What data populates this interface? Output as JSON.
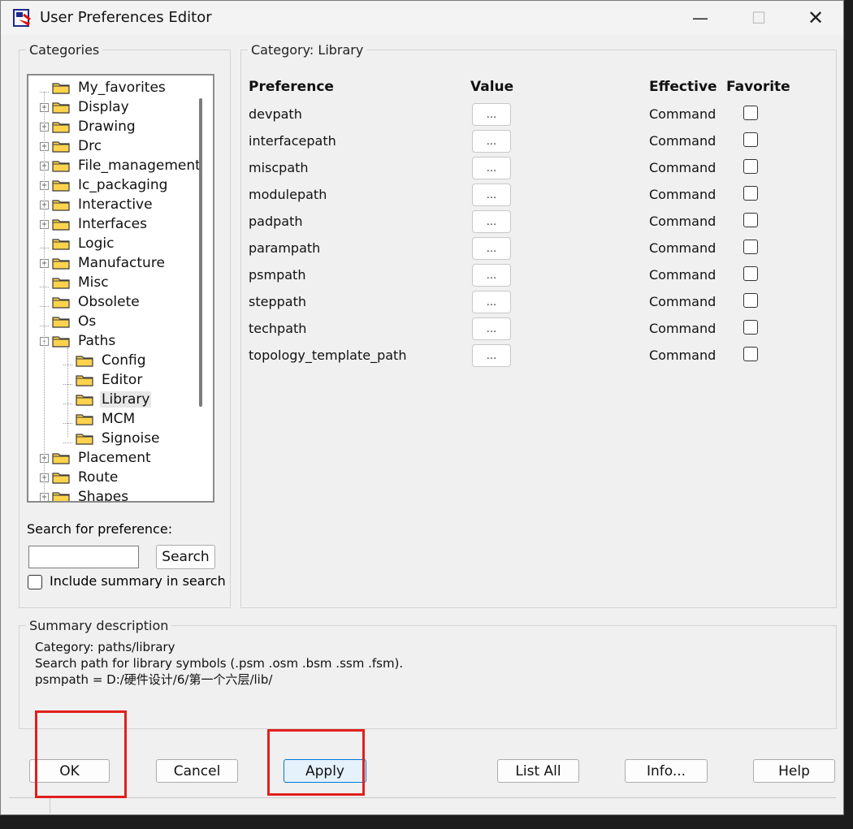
{
  "window": {
    "title": "User Preferences Editor"
  },
  "categories": {
    "label": "Categories",
    "tree": [
      {
        "label": "My_favorites",
        "expander": "",
        "level": 0
      },
      {
        "label": "Display",
        "expander": "+",
        "level": 0
      },
      {
        "label": "Drawing",
        "expander": "+",
        "level": 0
      },
      {
        "label": "Drc",
        "expander": "+",
        "level": 0
      },
      {
        "label": "File_management",
        "expander": "+",
        "level": 0
      },
      {
        "label": "Ic_packaging",
        "expander": "+",
        "level": 0
      },
      {
        "label": "Interactive",
        "expander": "+",
        "level": 0
      },
      {
        "label": "Interfaces",
        "expander": "+",
        "level": 0
      },
      {
        "label": "Logic",
        "expander": "",
        "level": 0
      },
      {
        "label": "Manufacture",
        "expander": "+",
        "level": 0
      },
      {
        "label": "Misc",
        "expander": "",
        "level": 0
      },
      {
        "label": "Obsolete",
        "expander": "",
        "level": 0
      },
      {
        "label": "Os",
        "expander": "",
        "level": 0
      },
      {
        "label": "Paths",
        "expander": "-",
        "level": 0
      },
      {
        "label": "Config",
        "expander": "",
        "level": 1
      },
      {
        "label": "Editor",
        "expander": "",
        "level": 1
      },
      {
        "label": "Library",
        "expander": "",
        "level": 1,
        "selected": true
      },
      {
        "label": "MCM",
        "expander": "",
        "level": 1
      },
      {
        "label": "Signoise",
        "expander": "",
        "level": 1
      },
      {
        "label": "Placement",
        "expander": "+",
        "level": 0
      },
      {
        "label": "Route",
        "expander": "+",
        "level": 0
      },
      {
        "label": "Shapes",
        "expander": "+",
        "level": 0
      }
    ]
  },
  "search": {
    "label": "Search for preference:",
    "value": "",
    "button": "Search",
    "include_summary_label": "Include summary in search",
    "include_summary_checked": false
  },
  "category_panel": {
    "label": "Category:  Library",
    "headers": {
      "preference": "Preference",
      "value": "Value",
      "effective": "Effective",
      "favorite": "Favorite"
    },
    "rows": [
      {
        "name": "devpath",
        "value_btn": "...",
        "effective": "Command"
      },
      {
        "name": "interfacepath",
        "value_btn": "...",
        "effective": "Command"
      },
      {
        "name": "miscpath",
        "value_btn": "...",
        "effective": "Command"
      },
      {
        "name": "modulepath",
        "value_btn": "...",
        "effective": "Command"
      },
      {
        "name": "padpath",
        "value_btn": "...",
        "effective": "Command"
      },
      {
        "name": "parampath",
        "value_btn": "...",
        "effective": "Command"
      },
      {
        "name": "psmpath",
        "value_btn": "...",
        "effective": "Command"
      },
      {
        "name": "steppath",
        "value_btn": "...",
        "effective": "Command"
      },
      {
        "name": "techpath",
        "value_btn": "...",
        "effective": "Command"
      },
      {
        "name": "topology_template_path",
        "value_btn": "...",
        "effective": "Command"
      }
    ]
  },
  "summary": {
    "label": "Summary description",
    "lines": [
      "Category: paths/library",
      "Search path for library symbols (.psm .osm .bsm .ssm .fsm).",
      "psmpath = D:/硬件设计/6/第一个六层/lib/"
    ]
  },
  "buttons": {
    "ok": "OK",
    "cancel": "Cancel",
    "apply": "Apply",
    "list_all": "List All",
    "info": "Info...",
    "help": "Help"
  },
  "colors": {
    "highlight_annotation": "#e0201c",
    "focus_border": "#0078d7",
    "folder_yellow": "#ffd34d"
  }
}
